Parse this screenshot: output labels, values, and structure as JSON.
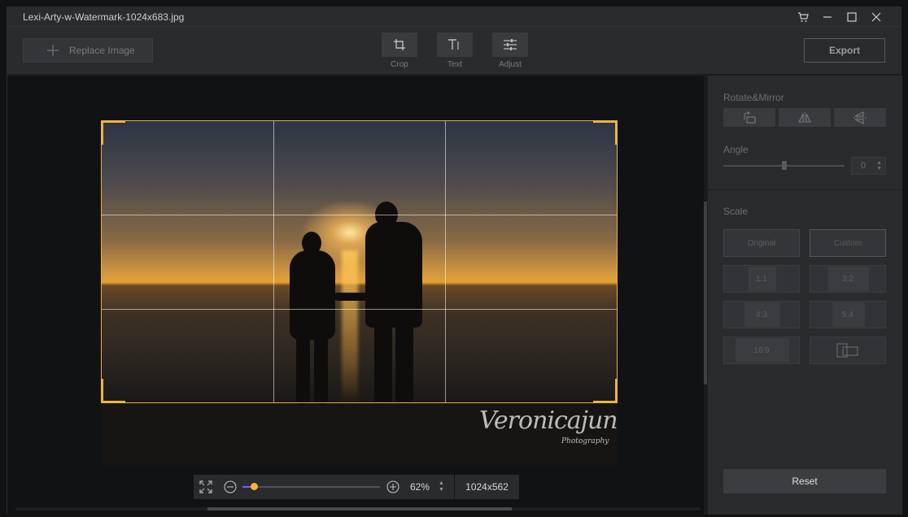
{
  "window": {
    "title": "Lexi-Arty-w-Watermark-1024x683.jpg"
  },
  "titlebar_icons": [
    "cart-icon",
    "minimize-icon",
    "maximize-icon",
    "close-icon"
  ],
  "toolbar": {
    "replace_label": "Replace Image",
    "tools": [
      {
        "label": "Crop",
        "icon": "crop-icon"
      },
      {
        "label": "Text",
        "icon": "text-icon"
      },
      {
        "label": "Adjust",
        "icon": "adjust-icon"
      }
    ],
    "export_label": "Export"
  },
  "photo": {
    "watermark_script": "Veronicajune",
    "watermark_sub": "Photography"
  },
  "zoom": {
    "percent": "62%",
    "size": "1024x562",
    "slider_level": 0.06,
    "accent": "#f2b62e"
  },
  "panel": {
    "rotate_title": "Rotate&Mirror",
    "rotate_buttons": [
      "rotate-icon",
      "flip-horizontal-icon",
      "flip-vertical-icon"
    ],
    "angle_title": "Angle",
    "angle_value": "0",
    "scale_title": "Scale",
    "scale_options": [
      "Original",
      "Custom",
      "1:1",
      "3:2",
      "4:3",
      "5:4",
      "16:9"
    ],
    "reset_label": "Reset"
  },
  "colors": {
    "crop_frame": "#f0b43a",
    "background": "#1e1f21"
  }
}
